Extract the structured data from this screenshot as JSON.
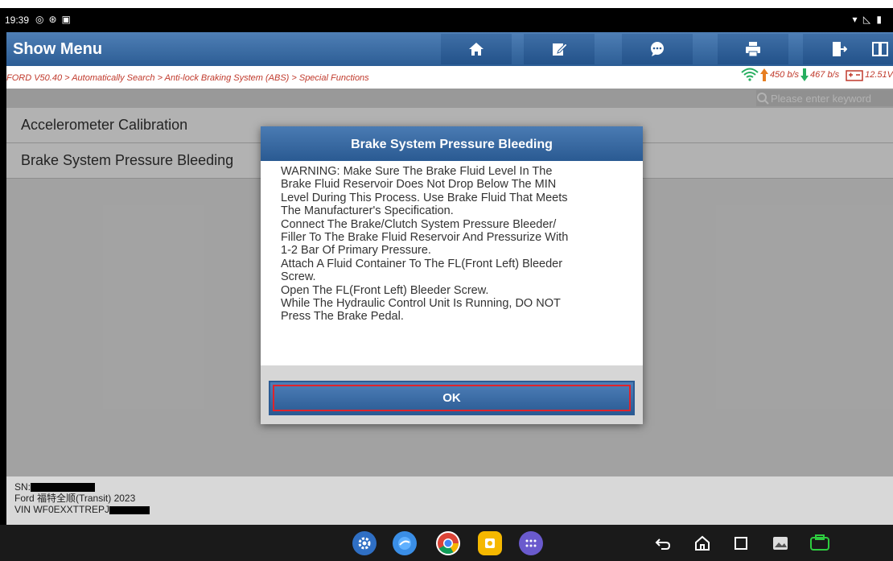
{
  "status_bar": {
    "time": "19:39"
  },
  "toolbar": {
    "title": "Show Menu",
    "buttons": [
      "home-icon",
      "edit-icon",
      "chat-icon",
      "print-icon",
      "exit-icon",
      "split-view-icon"
    ]
  },
  "breadcrumb": {
    "path": "FORD V50.40 > Automatically Search > Anti-lock Braking System (ABS) > Special Functions",
    "upload_rate": "450 b/s",
    "download_rate": "467 b/s",
    "battery_voltage": "12.51V"
  },
  "search": {
    "placeholder": "Please enter keyword"
  },
  "menu": {
    "items": [
      {
        "label": "Accelerometer Calibration"
      },
      {
        "label": "Brake System Pressure Bleeding"
      }
    ]
  },
  "footer": {
    "sn_label": "SN:",
    "vehicle": "Ford 福特全顺(Transit) 2023",
    "vin_label": "VIN WF0EXXTTREPJ"
  },
  "dialog": {
    "title": "Brake System Pressure Bleeding",
    "lines": [
      "WARNING: Make Sure The Brake Fluid Level In The",
      "Brake Fluid Reservoir Does Not Drop Below The MIN",
      "Level During This Process. Use Brake Fluid That Meets",
      "The Manufacturer's Specification.",
      "Connect The Brake/Clutch System Pressure Bleeder/",
      "Filler To The Brake Fluid Reservoir And Pressurize With",
      "1-2 Bar Of Primary Pressure.",
      "Attach A Fluid Container To The FL(Front Left) Bleeder",
      "Screw.",
      "Open The FL(Front Left) Bleeder Screw.",
      "While The Hydraulic Control Unit Is Running, DO NOT",
      "Press The Brake Pedal."
    ],
    "ok_label": "OK"
  },
  "colors": {
    "accent_blue": "#2c5d95",
    "breadcrumb_red": "#c0392b",
    "upload_orange": "#e67e22",
    "download_green": "#27ae60",
    "highlight_red": "#e0232b"
  }
}
